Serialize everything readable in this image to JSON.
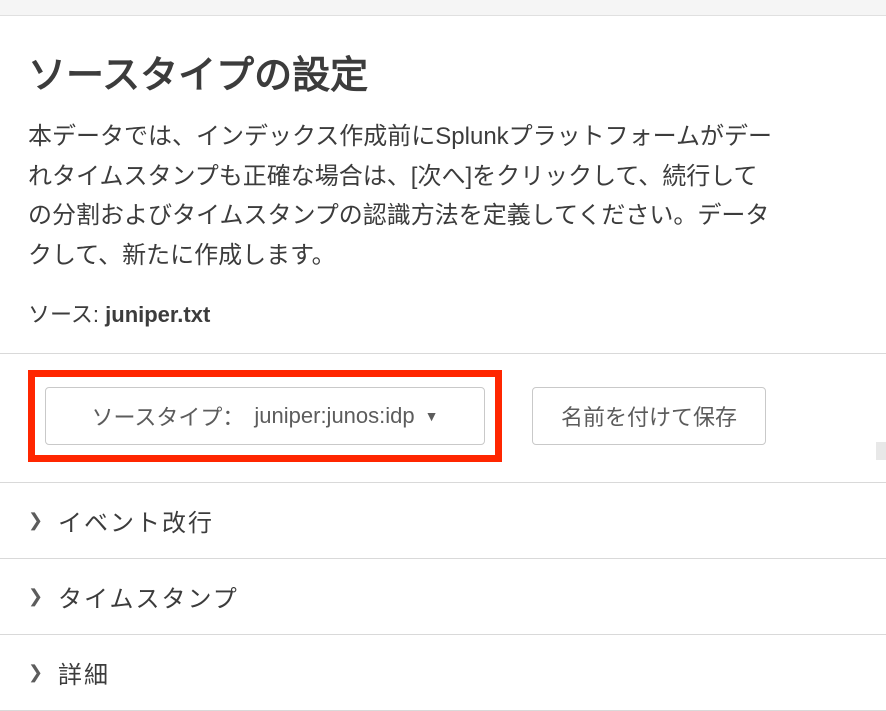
{
  "header": {
    "title": "ソースタイプの設定",
    "description_lines": [
      "本データでは、インデックス作成前にSplunkプラットフォームがデー",
      "れタイムスタンプも正確な場合は、[次へ]をクリックして、続行して",
      "の分割およびタイムスタンプの認識方法を定義してください。データ",
      "クして、新たに作成します。"
    ],
    "source_label": "ソース:",
    "source_file": "juniper.txt"
  },
  "controls": {
    "sourcetype_label": "ソースタイプ：",
    "sourcetype_value": "juniper:junos:idp",
    "save_as_label": "名前を付けて保存"
  },
  "accordion": {
    "items": [
      {
        "label": "イベント改行"
      },
      {
        "label": "タイムスタンプ"
      },
      {
        "label": "詳細"
      }
    ]
  }
}
